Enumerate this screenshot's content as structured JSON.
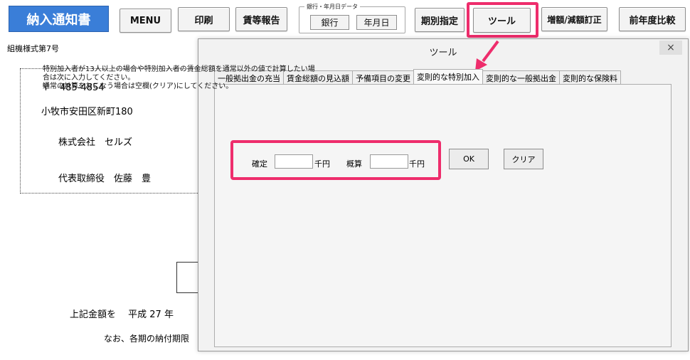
{
  "toolbar": {
    "title": "納入通知書",
    "menu": "MENU",
    "print": "印刷",
    "wage_report": "賃等報告",
    "group_label": "銀行・年月日データ",
    "bank": "銀行",
    "date": "年月日",
    "period": "期別指定",
    "tool": "ツール",
    "correction": "増額/減額訂正",
    "prev_year": "前年度比較"
  },
  "document": {
    "form_no": "組機様式第7号",
    "postal": "〒　485-4854",
    "address": "小牧市安田区新町180",
    "company": "株式会社　セルズ",
    "rep": "代表取締役　佐藤　豊",
    "line1": "上記金額を　 平成  27 年",
    "line2": "なお、各期の納付期限"
  },
  "dialog": {
    "title": "ツール",
    "close": "×",
    "tabs": [
      "一般拠出金の充当",
      "賃金総額の見込額",
      "予備項目の変更",
      "変則的な特別加入",
      "変則的な一般拠出金",
      "変則的な保険料"
    ],
    "active_tab": "変則的な特別加入",
    "instruction": "特別加入者が13人以上の場合や特別加入者の賃金総額を通常以外の値で計算したい場\n合は次に入力してください。\n通常の計算をおこなう場合は空欄(クリア)にしてください。",
    "fixed_label": "確定",
    "fixed_value": "",
    "fixed_unit": "千円",
    "estimate_label": "概算",
    "estimate_value": "",
    "estimate_unit": "千円",
    "ok": "OK",
    "clear": "クリア"
  },
  "colors": {
    "highlight": "#ee2d6c",
    "title_button": "#3a7ed8"
  }
}
